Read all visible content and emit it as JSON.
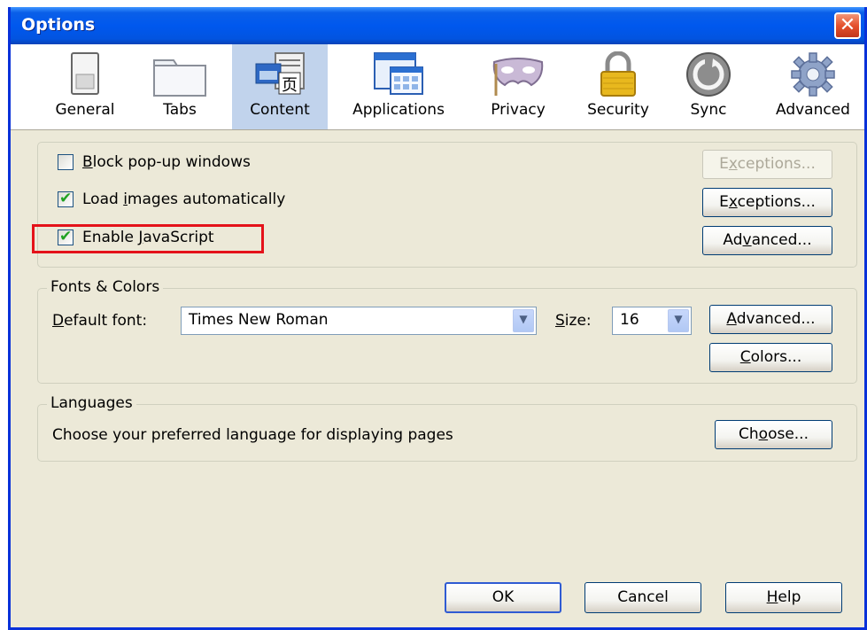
{
  "window": {
    "title": "Options",
    "close_symbol": "✕"
  },
  "tabs": [
    {
      "label": "General",
      "icon": "switch-icon"
    },
    {
      "label": "Tabs",
      "icon": "folder-tabs-icon"
    },
    {
      "label": "Content",
      "icon": "document-icon",
      "selected": true
    },
    {
      "label": "Applications",
      "icon": "applications-icon"
    },
    {
      "label": "Privacy",
      "icon": "mask-icon"
    },
    {
      "label": "Security",
      "icon": "padlock-icon"
    },
    {
      "label": "Sync",
      "icon": "sync-icon"
    },
    {
      "label": "Advanced",
      "icon": "gear-icon"
    }
  ],
  "content": {
    "block_popups": {
      "label_u": "B",
      "label_rest": "lock pop-up windows",
      "checked": false,
      "exceptions_pre": "E",
      "exceptions_u": "x",
      "exceptions_rest": "ceptions..."
    },
    "load_images": {
      "label_pre": "Load ",
      "label_u": "i",
      "label_rest": "mages automatically",
      "checked": true,
      "exceptions_pre": "E",
      "exceptions_u": "x",
      "exceptions_rest": "ceptions..."
    },
    "javascript": {
      "label_pre": "Enable ",
      "label_u": "J",
      "label_rest": "avaScript",
      "checked": true,
      "advanced_pre": "Ad",
      "advanced_u": "v",
      "advanced_rest": "anced..."
    }
  },
  "fonts": {
    "legend": "Fonts & Colors",
    "default_font_label_u": "D",
    "default_font_label_rest": "efault font:",
    "font_value": "Times New Roman",
    "size_label_u": "S",
    "size_label_rest": "ize:",
    "size_value": "16",
    "advanced_u": "A",
    "advanced_rest": "dvanced...",
    "colors_u": "C",
    "colors_rest": "olors..."
  },
  "languages": {
    "legend": "Languages",
    "description": "Choose your preferred language for displaying pages",
    "choose_pre": "Ch",
    "choose_u": "o",
    "choose_rest": "ose..."
  },
  "footer": {
    "ok": "OK",
    "cancel": "Cancel",
    "help_u": "H",
    "help_rest": "elp"
  },
  "colors": {
    "highlight": "#e4121a",
    "titlebar": "#0058ee",
    "selected_tab": "#c1d3ec",
    "check": "#21a121"
  }
}
